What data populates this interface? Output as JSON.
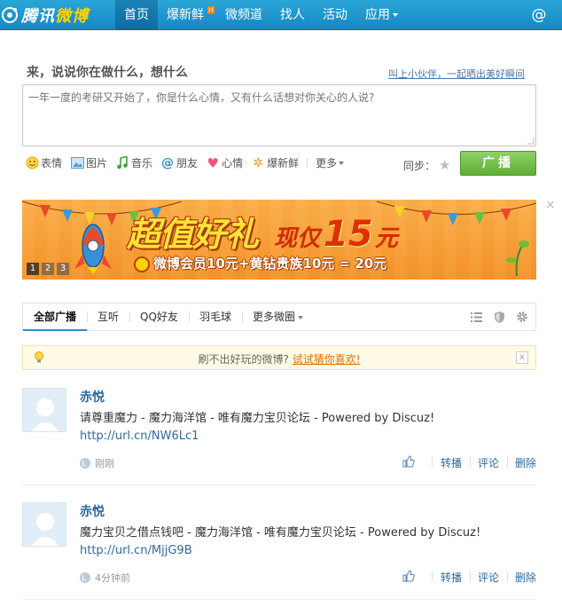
{
  "colors": {
    "topbar": "#1f96d0",
    "accent_link": "#2b6aa3",
    "broadcast_green": "#6fbf45",
    "tip_highlight": "#e07000"
  },
  "header": {
    "logo_text": "腾讯微博",
    "logo_text_a": "腾讯",
    "logo_text_b": "微博",
    "nav": [
      {
        "label": "首页",
        "active": true
      },
      {
        "label": "爆新鲜",
        "badge": "H"
      },
      {
        "label": "微频道"
      },
      {
        "label": "找人"
      },
      {
        "label": "活动"
      },
      {
        "label": "应用"
      }
    ],
    "at_icon": "@"
  },
  "composer": {
    "prompt": "来，说说你在做什么，想什么",
    "invite_link": "叫上小伙伴，一起晒出美好瞬间",
    "placeholder": "一年一度的考研又开始了，你是什么心情，又有什么话想对你关心的人说?",
    "tools": [
      {
        "label": "表情",
        "icon": "smiley-icon"
      },
      {
        "label": "图片",
        "icon": "image-icon"
      },
      {
        "label": "音乐",
        "icon": "music-icon"
      },
      {
        "label": "朋友",
        "icon": "at-icon"
      },
      {
        "label": "心情",
        "icon": "heart-icon"
      },
      {
        "label": "爆新鲜",
        "icon": "sparkle-icon"
      },
      {
        "label": "更多",
        "icon": "chevron-down-icon"
      }
    ],
    "sync_label": "同步：",
    "broadcast_button": "广播"
  },
  "banner": {
    "headline": "超值好礼",
    "price_prefix": "现仅",
    "price_value": "15",
    "price_unit": "元",
    "subline": "微博会员10元+黄钻贵族10元 = 20元",
    "pages": [
      "1",
      "2",
      "3"
    ],
    "close": "×"
  },
  "tabs": {
    "items": [
      {
        "label": "全部广播",
        "active": true
      },
      {
        "label": "互听"
      },
      {
        "label": "QQ好友"
      },
      {
        "label": "羽毛球"
      },
      {
        "label": "更多微圈"
      }
    ],
    "icons": [
      "list-view-icon",
      "shield-icon",
      "gear-icon"
    ]
  },
  "tip": {
    "text": "刷不出好玩的微博?",
    "link": "试试猜你喜欢!",
    "close": "x"
  },
  "posts": [
    {
      "author": "赤悦",
      "content": "请尊重魔力 - 魔力海洋馆 - 唯有魔力宝贝论坛 - Powered by Discuz!",
      "link": "http://url.cn/NW6Lc1",
      "time": "刚刚",
      "actions": [
        "转播",
        "评论",
        "删除"
      ]
    },
    {
      "author": "赤悦",
      "content": "魔力宝贝之借点钱吧 - 魔力海洋馆 - 唯有魔力宝贝论坛 - Powered by Discuz!",
      "link": "http://url.cn/MjjG9B",
      "time": "4分钟前",
      "actions": [
        "转播",
        "评论",
        "删除"
      ]
    }
  ]
}
